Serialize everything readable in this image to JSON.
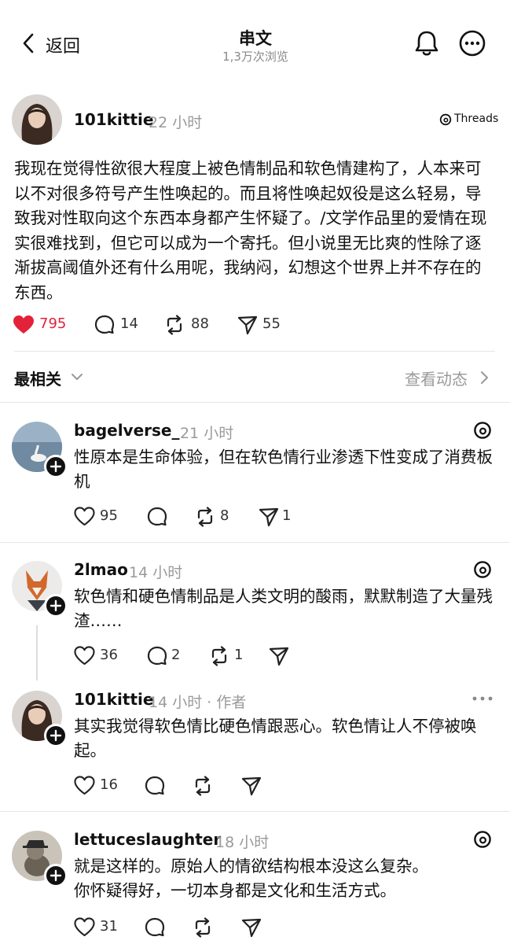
{
  "header": {
    "back_label": "返回",
    "title": "串文",
    "views": "1,3万次浏览"
  },
  "post": {
    "username": "101kittie",
    "time": "22 小时",
    "badge": "Threads",
    "body": "我现在觉得性欲很大程度上被色情制品和软色情建构了，人本来可以不对很多符号产生性唤起的。而且将性唤起奴役是这么轻易，导致我对性取向这个东西本身都产生怀疑了。/文学作品里的爱情在现实很难找到，但它可以成为一个寄托。但小说里无比爽的性除了逐渐拔高阈值外还有什么用呢，我纳闷，幻想这个世界上并不存在的东西。",
    "likes": "795",
    "comments": "14",
    "reposts": "88",
    "shares": "55",
    "liked_color": "#e3223a"
  },
  "sort": {
    "label": "最相关",
    "activity_label": "查看动态"
  },
  "replies": [
    {
      "username": "bagelverse_",
      "time": "21 小时",
      "body": "性原本是生命体验，但在软色情行业渗透下性变成了消费板机",
      "likes": "95",
      "comments": "",
      "reposts": "8",
      "shares": "1"
    },
    {
      "username": "2lmao",
      "time": "14 小时",
      "body": "软色情和硬色情制品是人类文明的酸雨，默默制造了大量残渣……",
      "likes": "36",
      "comments": "2",
      "reposts": "1",
      "shares": ""
    },
    {
      "username": "101kittie",
      "time": "14 小时 · 作者",
      "body": "其实我觉得软色情比硬色情跟恶心。软色情让人不停被唤起。",
      "likes": "16",
      "comments": "",
      "reposts": "",
      "shares": ""
    },
    {
      "username": "lettuceslaughter",
      "time": "18 小时",
      "body_line1": "就是这样的。原始人的情欲结构根本没这么复杂。",
      "body_line2": "你怀疑得好，一切本身都是文化和生活方式。",
      "likes": "31",
      "comments": "",
      "reposts": "",
      "shares": ""
    }
  ]
}
